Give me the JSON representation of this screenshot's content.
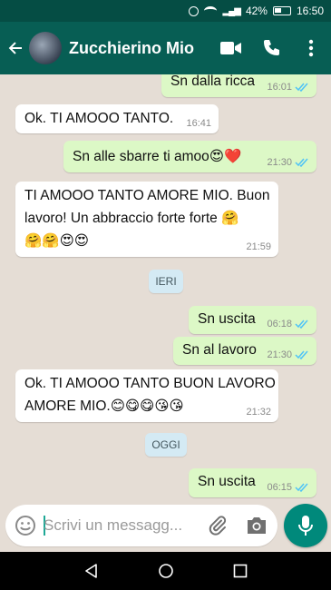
{
  "status_bar": {
    "battery": "42%",
    "time": "16:50"
  },
  "header": {
    "contact_name": "Zucchierino Mio"
  },
  "date_chips": {
    "yesterday": "IERI",
    "today": "OGGI"
  },
  "messages": [
    {
      "direction": "out",
      "text": "Sn dalla ricca",
      "time": "16:01",
      "read": true
    },
    {
      "direction": "in",
      "text": "Ok. TI AMOOO TANTO.",
      "time": "16:41"
    },
    {
      "direction": "out",
      "text": "Sn alle sbarre ti amoo",
      "emoji": "😍❤️",
      "time": "21:30",
      "read": true
    },
    {
      "direction": "in",
      "line1": "TI AMOOO TANTO AMORE MIO. Buon",
      "line2": "lavoro! Un abbraccio forte forte",
      "line2_emoji": "🤗",
      "line3_emoji": "🤗🤗😍😍",
      "time": "21:59"
    },
    {
      "direction": "out",
      "text": "Sn uscita",
      "time": "06:18",
      "read": true
    },
    {
      "direction": "out",
      "text": "Sn al lavoro",
      "time": "21:30",
      "read": true
    },
    {
      "direction": "in",
      "line1": "Ok. TI AMOOO TANTO BUON LAVORO",
      "line2": "AMORE MIO.",
      "line2_emoji": "😊😋😋😘😘",
      "time": "21:32"
    },
    {
      "direction": "out",
      "text": "Sn uscita",
      "time": "06:15",
      "read": true
    }
  ],
  "composer": {
    "placeholder": "Scrivi un messagg..."
  },
  "colors": {
    "header": "#075e54",
    "status": "#054d44",
    "outgoing": "#dcf8c6",
    "incoming": "#ffffff",
    "accent": "#00897b",
    "read_ticks": "#4fc3f7"
  },
  "icons": [
    "back-arrow-icon",
    "video-call-icon",
    "phone-icon",
    "more-vert-icon",
    "emoji-icon",
    "attach-icon",
    "camera-icon",
    "mic-icon",
    "nav-back-icon",
    "nav-home-icon",
    "nav-recents-icon"
  ]
}
